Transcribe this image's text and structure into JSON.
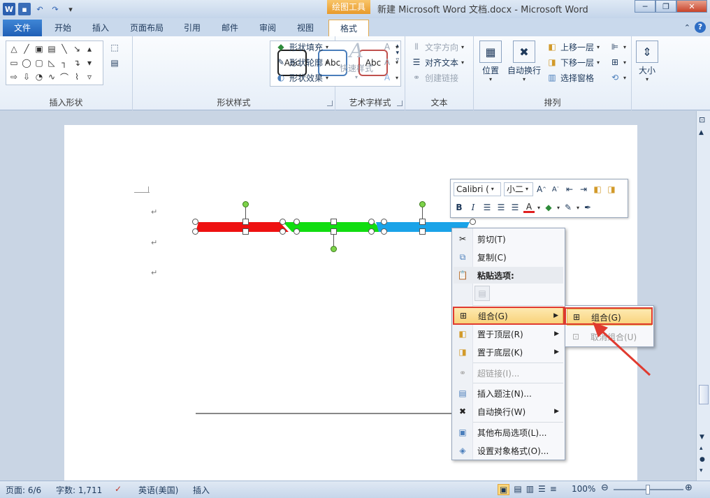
{
  "titlebar": {
    "context_tab": "绘图工具",
    "document_title": "新建 Microsoft Word 文档.docx - Microsoft Word",
    "minimize": "─",
    "restore": "❐",
    "close": "✕"
  },
  "tabs": [
    "文件",
    "开始",
    "插入",
    "页面布局",
    "引用",
    "邮件",
    "审阅",
    "视图",
    "格式"
  ],
  "ribbon": {
    "groups": {
      "insert_shapes": "插入形状",
      "shape_styles": "形状样式",
      "wordart_styles": "艺术字样式",
      "text": "文本",
      "arrange": "排列"
    },
    "style_samples": [
      "Abc",
      "Abc",
      "Abc"
    ],
    "shape_fill": "形状填充",
    "shape_outline": "形状轮廓",
    "shape_effects": "形状效果",
    "quick_styles": "快速样式",
    "text_direction": "文字方向",
    "align_text": "对齐文本",
    "create_link": "创建链接",
    "position": "位置",
    "wrap_text": "自动换行",
    "bring_forward": "上移一层",
    "send_backward": "下移一层",
    "selection_pane": "选择窗格",
    "size": "大小"
  },
  "minibar": {
    "font": "Calibri (",
    "size": "小二"
  },
  "context_menu": {
    "cut": "剪切(T)",
    "copy": "复制(C)",
    "paste_options": "粘贴选项:",
    "group": "组合(G)",
    "bring_to_front": "置于顶层(R)",
    "send_to_back": "置于底层(K)",
    "hyperlink": "超链接(I)...",
    "insert_caption": "插入题注(N)...",
    "wrap_text": "自动换行(W)",
    "more_layout": "其他布局选项(L)...",
    "format_object": "设置对象格式(O)..."
  },
  "submenu": {
    "group": "组合(G)",
    "ungroup": "取消组合(U)"
  },
  "status": {
    "page": "页面: 6/6",
    "words": "字数: 1,711",
    "language": "英语(美国)",
    "mode": "插入",
    "zoom": "100%"
  },
  "colors": {
    "red_segment": "#ee1111",
    "green_segment": "#11dd11",
    "blue_segment": "#1aa3e8",
    "highlight_box": "#e03a2f",
    "accent": "#1f5fb6"
  }
}
